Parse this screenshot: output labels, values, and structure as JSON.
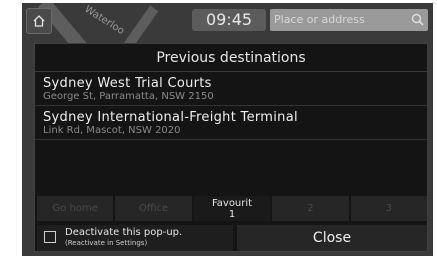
{
  "status": {
    "time": "09:45"
  },
  "search": {
    "placeholder": "Place or address"
  },
  "map": {
    "street_label": "Waterloo"
  },
  "dialog": {
    "title": "Previous destinations",
    "destinations": [
      {
        "name": "Sydney West Trial Courts",
        "address": "George St, Parramatta, NSW 2150"
      },
      {
        "name": "Sydney International-Freight Terminal",
        "address": "Link Rd, Mascot, NSW 2020"
      }
    ],
    "favourites": [
      {
        "label": "Go home",
        "sub": ""
      },
      {
        "label": "Office",
        "sub": ""
      },
      {
        "label": "Favourit",
        "sub": "1"
      },
      {
        "label": "2",
        "sub": ""
      },
      {
        "label": "3",
        "sub": ""
      }
    ],
    "deactivate_label": "Deactivate this pop-up.",
    "deactivate_sub": "(Reactivate in Settings)",
    "close_label": "Close"
  },
  "icons": {
    "home": "home-icon",
    "search": "search-icon",
    "checkbox": "checkbox-icon"
  }
}
